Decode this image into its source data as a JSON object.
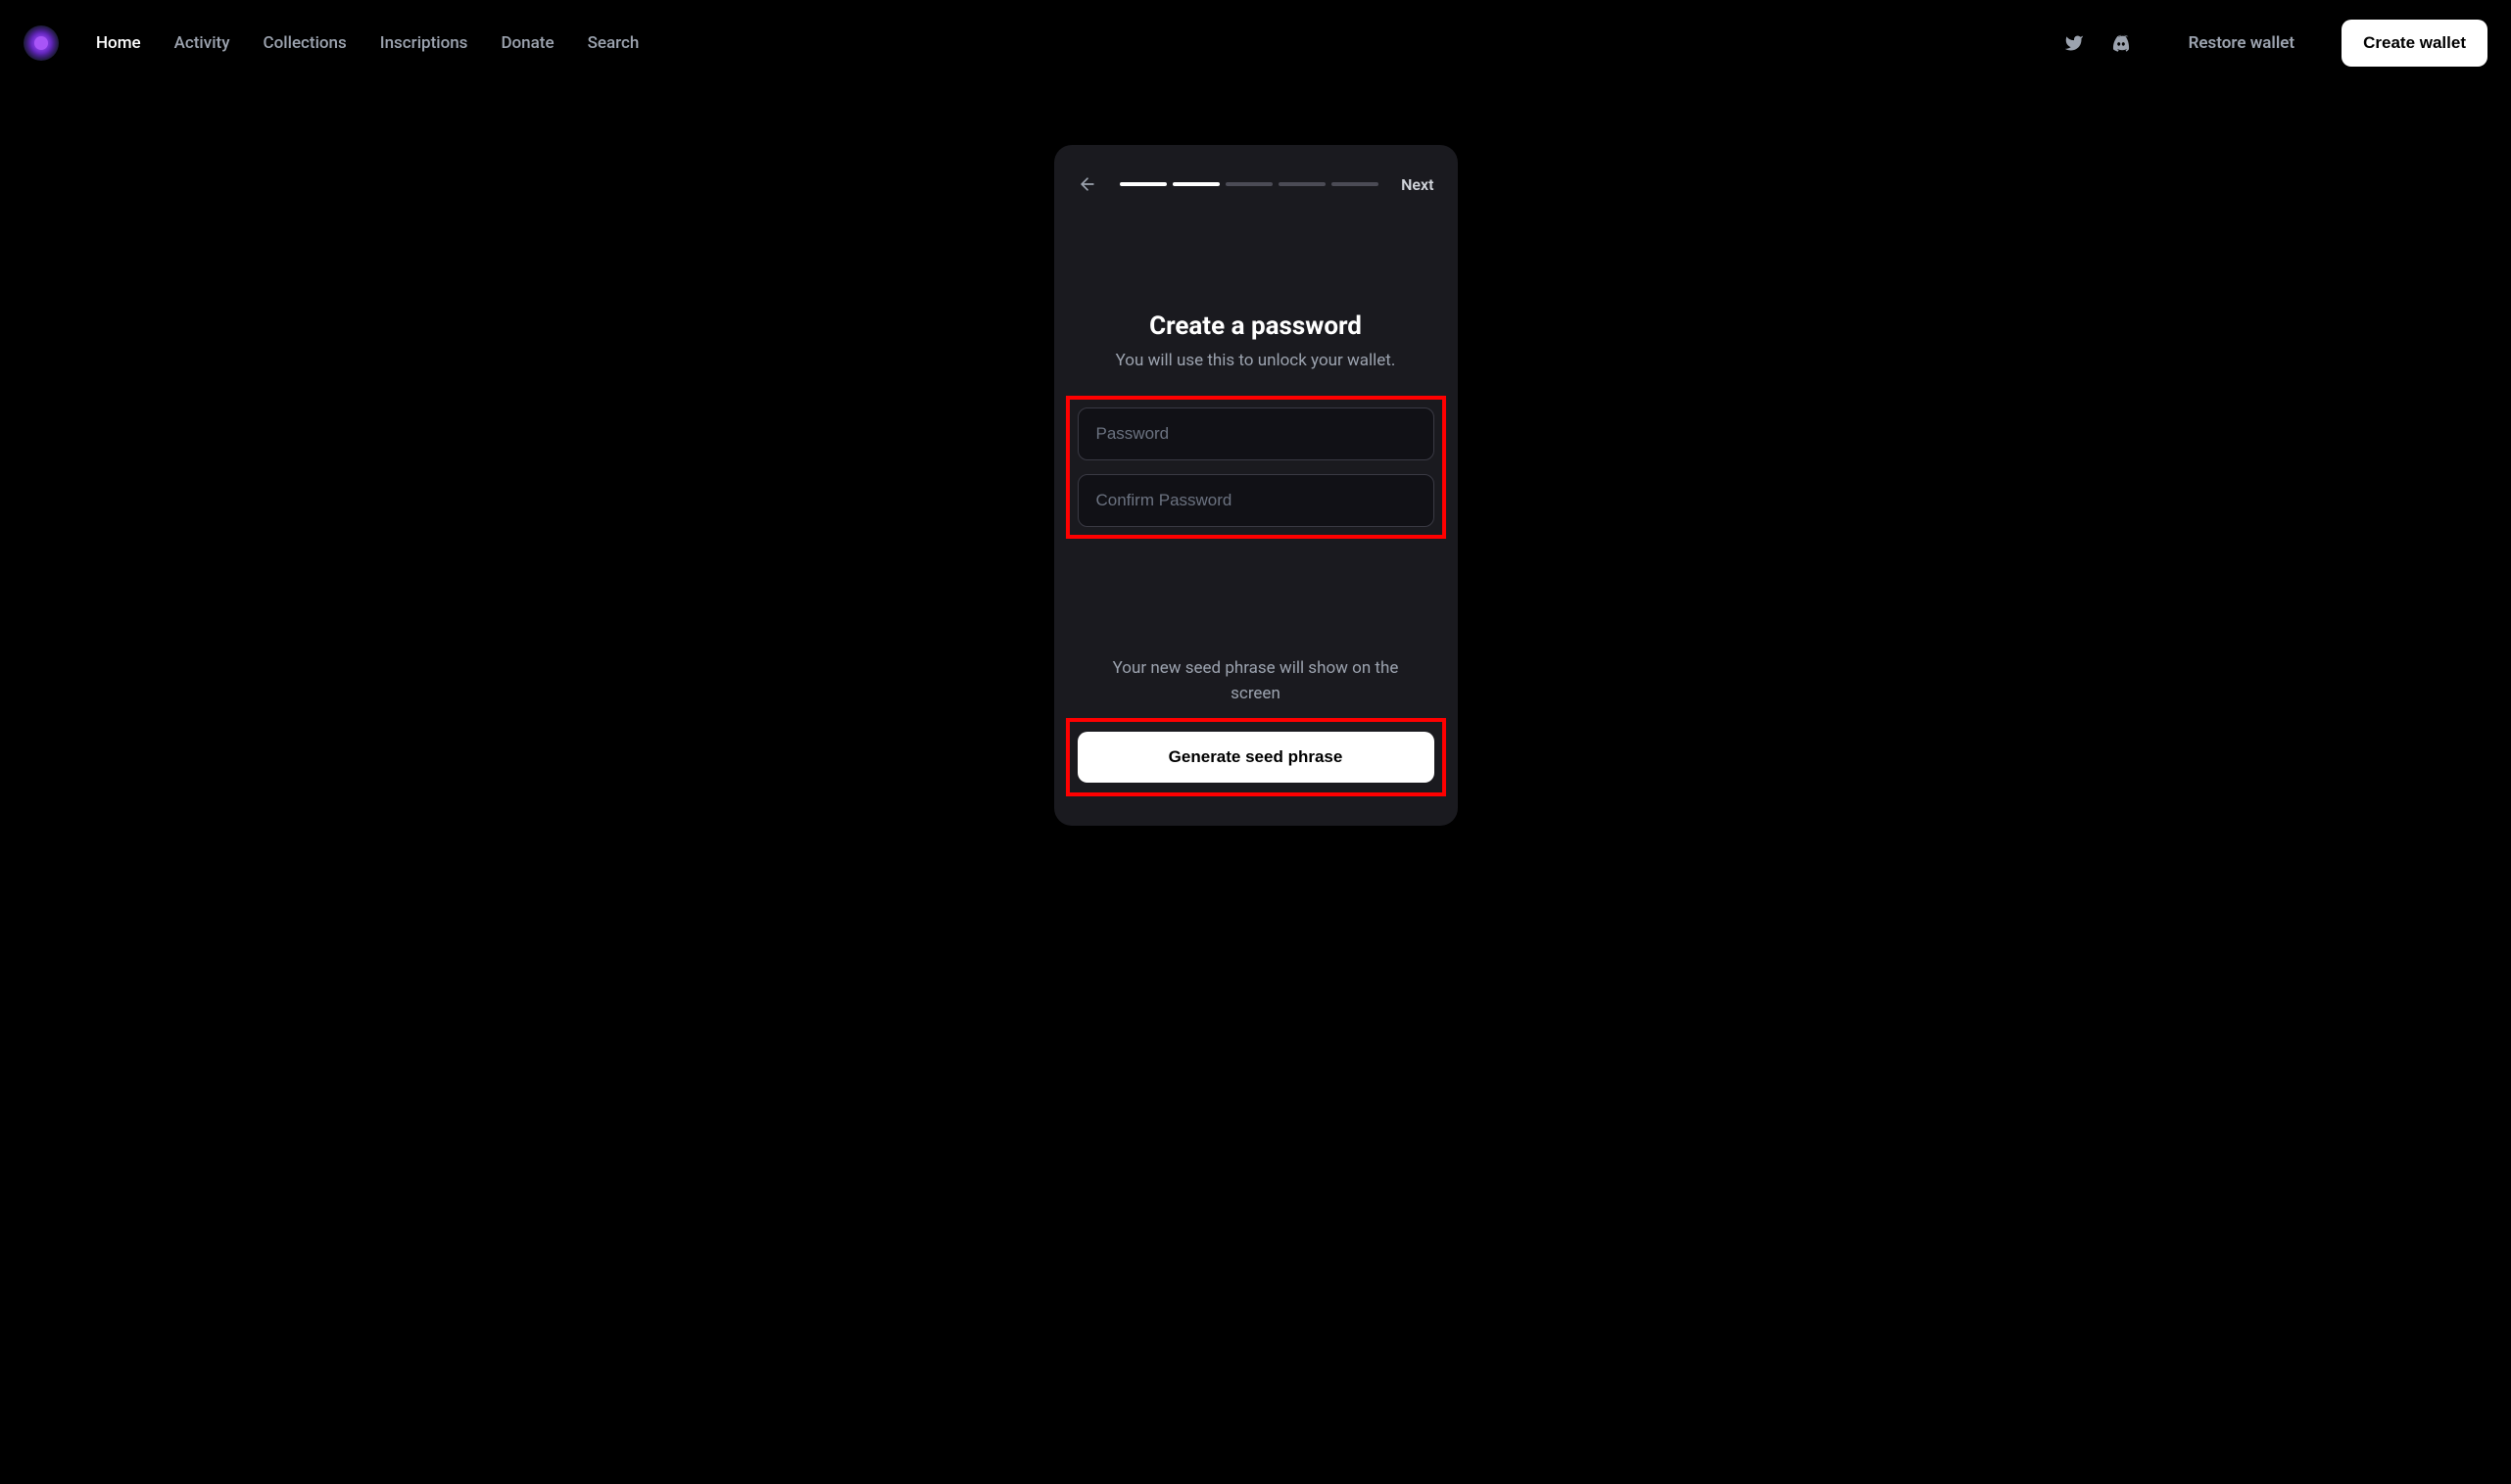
{
  "nav": {
    "items": [
      {
        "label": "Home",
        "active": true
      },
      {
        "label": "Activity",
        "active": false
      },
      {
        "label": "Collections",
        "active": false
      },
      {
        "label": "Inscriptions",
        "active": false
      },
      {
        "label": "Donate",
        "active": false
      },
      {
        "label": "Search",
        "active": false
      }
    ],
    "restore_label": "Restore wallet",
    "create_label": "Create wallet"
  },
  "panel": {
    "next_label": "Next",
    "progress_total": 5,
    "progress_done": 2,
    "title": "Create a password",
    "subtitle": "You will use this to unlock your wallet.",
    "password_placeholder": "Password",
    "confirm_placeholder": "Confirm Password",
    "seed_note": "Your new seed phrase will show on the screen",
    "generate_label": "Generate seed phrase"
  }
}
